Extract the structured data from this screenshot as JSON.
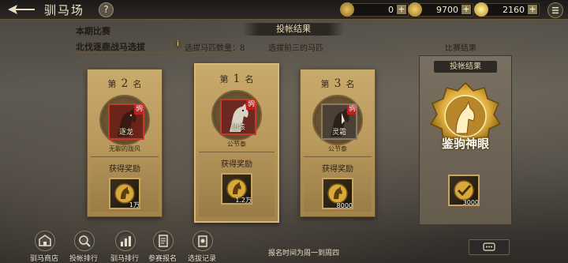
{
  "window": {
    "title": "驯马场",
    "help_symbol": "?"
  },
  "resources": [
    {
      "icon": "scroll-icon",
      "value": "0",
      "plus": "+"
    },
    {
      "icon": "coin-icon",
      "value": "9700",
      "plus": "+"
    },
    {
      "icon": "gold-ingot-icon",
      "value": "2160",
      "plus": "+"
    }
  ],
  "header": {
    "result_banner": "投帐结果",
    "period": "本期比赛",
    "event": "北伐逐鹿战马选拔",
    "count_label": "选拔马匹数量：8",
    "pick_label": "选拔前三的马匹",
    "match_result": "比赛结果"
  },
  "cards": [
    {
      "rank_prefix": "第",
      "rank": "2",
      "rank_suffix": "名",
      "horse_name": "逐龙",
      "tag": "驹",
      "owner": "无聊的跋风",
      "reward_label": "获得奖励",
      "reward_value": "1万"
    },
    {
      "rank_prefix": "第",
      "rank": "1",
      "rank_suffix": "名",
      "horse_name": "仙咳",
      "tag": "驹",
      "owner": "公节泰",
      "reward_label": "获得奖励",
      "reward_value": "1.2万"
    },
    {
      "rank_prefix": "第",
      "rank": "3",
      "rank_suffix": "名",
      "horse_name": "灵霜",
      "tag": "驹",
      "owner": "公节泰",
      "reward_label": "获得奖励",
      "reward_value": "8000"
    }
  ],
  "panel": {
    "title": "投帐结果",
    "medal_text": "鉴驹神眼",
    "reward_value": "3000"
  },
  "nav": [
    {
      "label": "驯马商店",
      "icon": "shop-icon"
    },
    {
      "label": "投帐排行",
      "icon": "magnifier-icon"
    },
    {
      "label": "驯马排行",
      "icon": "bar-chart-icon"
    },
    {
      "label": "参赛报名",
      "icon": "register-icon"
    },
    {
      "label": "选拔记录",
      "icon": "record-icon"
    }
  ],
  "notice": "报名时间为周一到周四",
  "colors": {
    "accent_gold": "#c9a55a",
    "tag_red": "#c21e1e"
  }
}
